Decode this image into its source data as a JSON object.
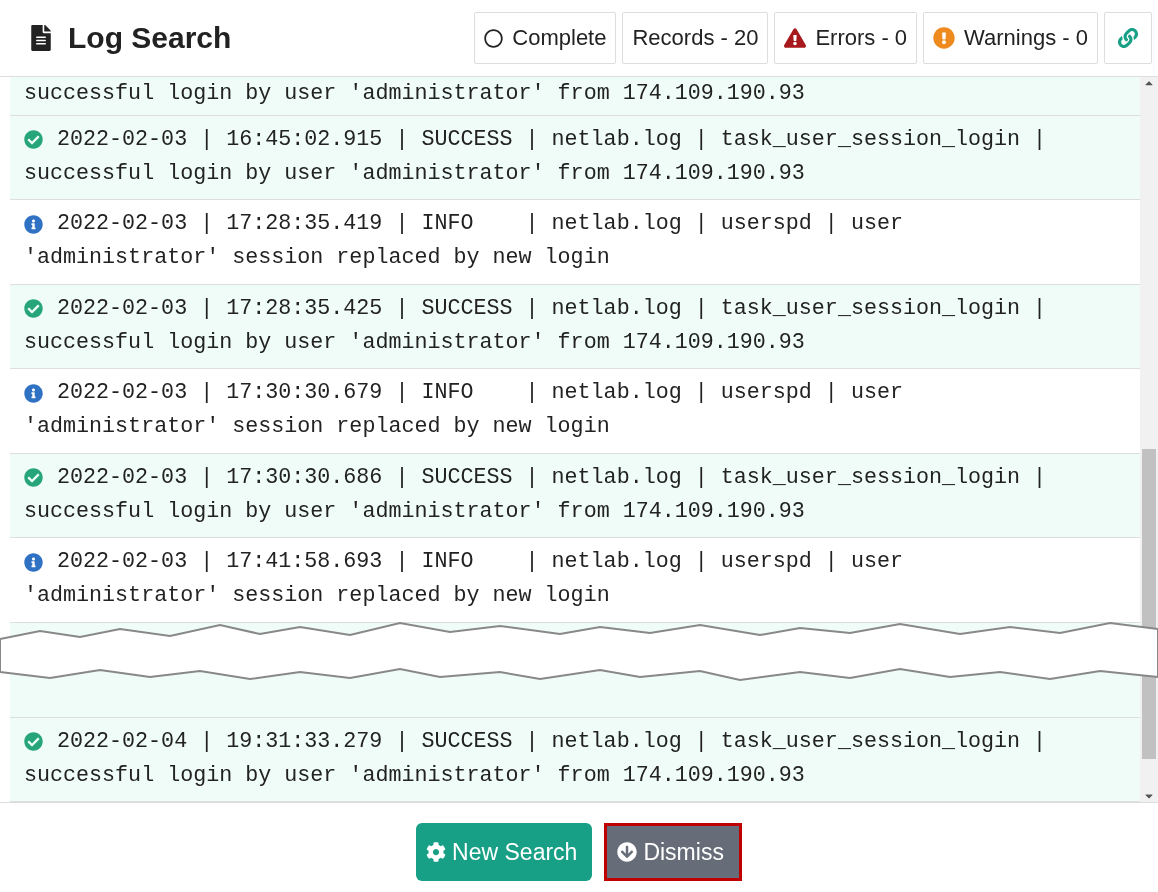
{
  "header": {
    "title": "Log Search",
    "badges": [
      {
        "kind": "status",
        "label": "Complete"
      },
      {
        "kind": "count",
        "label": "Records - 20"
      },
      {
        "kind": "error",
        "label": "Errors - 0"
      },
      {
        "kind": "warning",
        "label": "Warnings - 0"
      },
      {
        "kind": "link"
      }
    ]
  },
  "log": {
    "partial_first": {
      "kind": "success",
      "text": "successful login by user 'administrator' from 174.109.190.93"
    },
    "entries": [
      {
        "kind": "success",
        "text": "2022-02-03 | 16:45:02.915 | SUCCESS | netlab.log | task_user_session_login |\nsuccessful login by user 'administrator' from 174.109.190.93"
      },
      {
        "kind": "info",
        "text": "2022-02-03 | 17:28:35.419 | INFO    | netlab.log | userspd | user\n'administrator' session replaced by new login"
      },
      {
        "kind": "success",
        "text": "2022-02-03 | 17:28:35.425 | SUCCESS | netlab.log | task_user_session_login |\nsuccessful login by user 'administrator' from 174.109.190.93"
      },
      {
        "kind": "info",
        "text": "2022-02-03 | 17:30:30.679 | INFO    | netlab.log | userspd | user\n'administrator' session replaced by new login"
      },
      {
        "kind": "success",
        "text": "2022-02-03 | 17:30:30.686 | SUCCESS | netlab.log | task_user_session_login |\nsuccessful login by user 'administrator' from 174.109.190.93"
      },
      {
        "kind": "info",
        "text": "2022-02-03 | 17:41:58.693 | INFO    | netlab.log | userspd | user\n'administrator' session replaced by new login"
      }
    ],
    "after_tear": [
      {
        "kind": "success",
        "text": "2022-02-04 | 19:31:33.279 | SUCCESS | netlab.log | task_user_session_login |\nsuccessful login by user 'administrator' from 174.109.190.93"
      }
    ]
  },
  "buttons": [
    {
      "kind": "new",
      "label": "New Search",
      "highlighted": false
    },
    {
      "kind": "dismiss",
      "label": "Dismiss",
      "highlighted": true
    }
  ]
}
